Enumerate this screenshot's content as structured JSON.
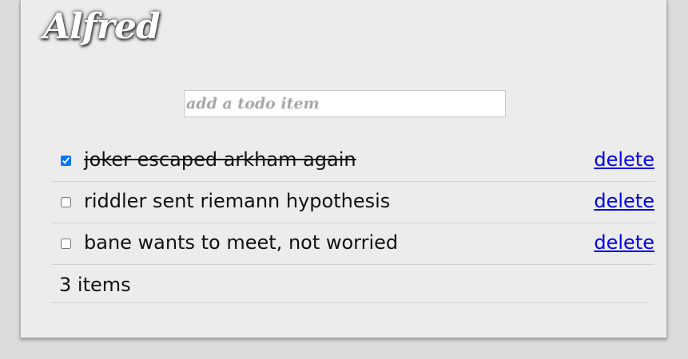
{
  "app": {
    "title": "Alfred"
  },
  "new_todo": {
    "placeholder": "add a todo item",
    "value": ""
  },
  "todos": [
    {
      "text": "joker escaped arkham again",
      "completed": true,
      "delete_label": "delete"
    },
    {
      "text": "riddler sent riemann hypothesis",
      "completed": false,
      "delete_label": "delete"
    },
    {
      "text": "bane wants to meet, not worried",
      "completed": false,
      "delete_label": "delete"
    }
  ],
  "footer": {
    "count_text": "3 items"
  },
  "colors": {
    "page_background": "#dcdcdc",
    "card_background": "#ececec",
    "link": "#0000ee"
  }
}
